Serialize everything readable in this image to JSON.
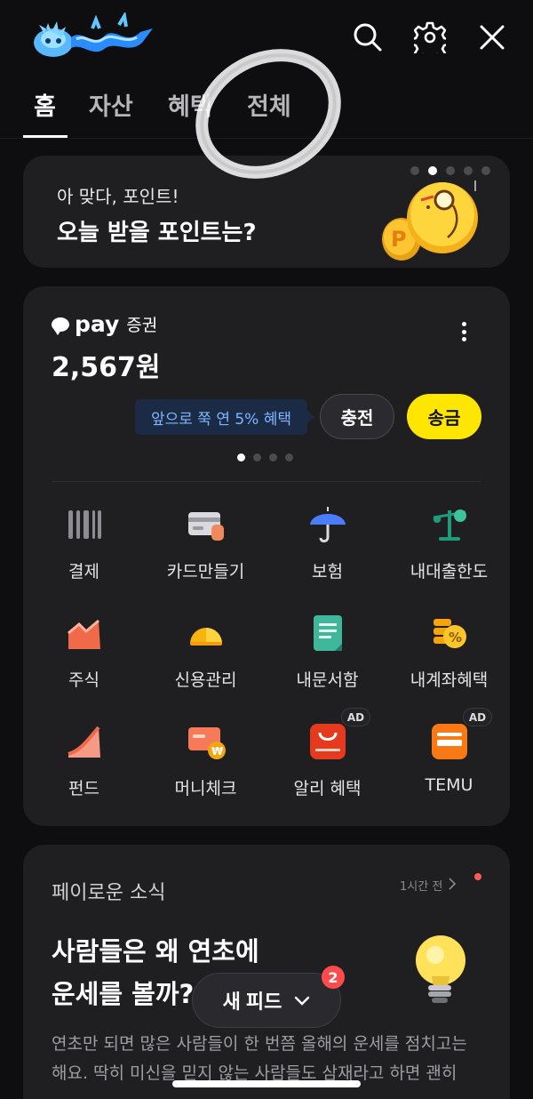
{
  "header": {
    "logo_icon": "blue-dragon-logo",
    "search_icon": "search-icon",
    "settings_icon": "gear-icon",
    "close_icon": "close-icon"
  },
  "tabs": [
    {
      "label": "홈",
      "active": true
    },
    {
      "label": "자산",
      "active": false
    },
    {
      "label": "혜택",
      "active": false
    },
    {
      "label": "전체",
      "active": false
    }
  ],
  "promo": {
    "subtitle": "아 맞다, 포인트!",
    "title": "오늘 받을 포인트는?",
    "carousel_total": 5,
    "carousel_active": 2
  },
  "pay": {
    "brand": "pay",
    "brand_suffix": "증권",
    "balance": "2,567원",
    "tooltip": "앞으로 쭉 연 5% 혜택",
    "charge_label": "충전",
    "send_label": "송금",
    "page_total": 4,
    "page_active": 1,
    "accent": "#FFE600"
  },
  "services": [
    {
      "label": "결제",
      "icon": "barcode-icon",
      "ad": ""
    },
    {
      "label": "카드만들기",
      "icon": "card-icon",
      "ad": ""
    },
    {
      "label": "보험",
      "icon": "umbrella-icon",
      "ad": ""
    },
    {
      "label": "내대출한도",
      "icon": "scale-icon",
      "ad": ""
    },
    {
      "label": "주식",
      "icon": "stock-chart-icon",
      "ad": ""
    },
    {
      "label": "신용관리",
      "icon": "credit-gauge-icon",
      "ad": ""
    },
    {
      "label": "내문서함",
      "icon": "document-icon",
      "ad": ""
    },
    {
      "label": "내계좌혜택",
      "icon": "coin-percent-icon",
      "ad": ""
    },
    {
      "label": "펀드",
      "icon": "fund-chart-icon",
      "ad": ""
    },
    {
      "label": "머니체크",
      "icon": "money-check-icon",
      "ad": ""
    },
    {
      "label": "알리 혜택",
      "icon": "aliexpress-icon",
      "ad": "AD"
    },
    {
      "label": "TEMU",
      "icon": "temu-icon",
      "ad": "AD"
    }
  ],
  "news": {
    "section": "페이로운 소식",
    "time": "1시간 전",
    "title_line1": "사람들은 왜 연초에",
    "title_line2": "운세를 볼까?",
    "body": "연초만 되면 많은 사람들이 한 번쯤 올해의 운세를 점치고는 해요. 딱히 미신을 믿지 않는 사람들도 삼재라고 하면 괜히"
  },
  "feed": {
    "label": "새 피드",
    "badge": "2"
  }
}
